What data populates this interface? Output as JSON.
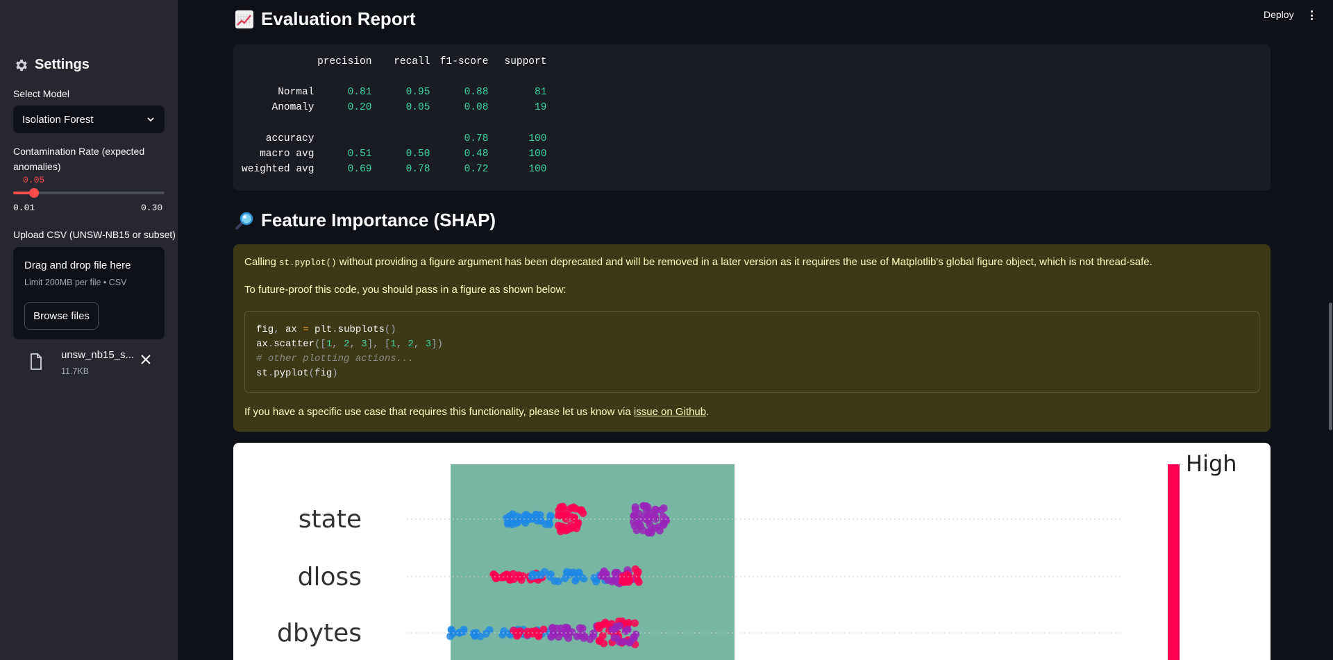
{
  "header": {
    "deploy_label": "Deploy"
  },
  "sidebar": {
    "title": "Settings",
    "model": {
      "label": "Select Model",
      "value": "Isolation Forest"
    },
    "contamination": {
      "label": "Contamination Rate (expected anomalies)",
      "value": "0.05",
      "value_fraction": 0.1379,
      "min": "0.01",
      "max": "0.30"
    },
    "upload": {
      "label": "Upload CSV (UNSW-NB15 or subset)",
      "drop_title": "Drag and drop file here",
      "drop_sub": "Limit 200MB per file • CSV",
      "browse_label": "Browse files",
      "file_name": "unsw_nb15_s...",
      "file_size": "11.7KB"
    }
  },
  "evaluation": {
    "title": "Evaluation Report",
    "columns": [
      "precision",
      "recall",
      "f1-score",
      "support"
    ],
    "rows": [
      {
        "label": "Normal",
        "values": [
          "0.81",
          "0.95",
          "0.88",
          "81"
        ]
      },
      {
        "label": "Anomaly",
        "values": [
          "0.20",
          "0.05",
          "0.08",
          "19"
        ]
      },
      {
        "label": "accuracy",
        "values": [
          "",
          "",
          "0.78",
          "100"
        ]
      },
      {
        "label": "macro avg",
        "values": [
          "0.51",
          "0.50",
          "0.48",
          "100"
        ]
      },
      {
        "label": "weighted avg",
        "values": [
          "0.69",
          "0.78",
          "0.72",
          "100"
        ]
      }
    ]
  },
  "shap": {
    "title": "Feature Importance (SHAP)",
    "warning": {
      "p1_pre": "Calling ",
      "p1_code": "st.pyplot()",
      "p1_post": " without providing a figure argument has been deprecated and will be removed in a later version as it requires the use of Matplotlib's global figure object, which is not thread-safe.",
      "p2": "To future-proof this code, you should pass in a figure as shown below:",
      "p3_pre": "If you have a specific use case that requires this functionality, please let us know via ",
      "p3_link": "issue on Github",
      "p3_post": "."
    },
    "plot": {
      "features": [
        "state",
        "dloss",
        "dbytes"
      ],
      "legend_high": "High",
      "colors": {
        "low": "#1e88e5",
        "high": "#ff0052",
        "mid": "#9a24b8",
        "highlight": "#78b6a4"
      }
    }
  }
}
